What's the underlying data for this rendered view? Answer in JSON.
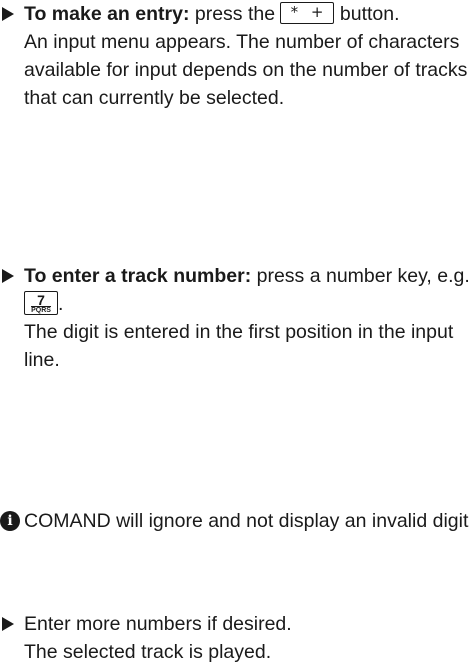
{
  "step1": {
    "bold": "To make an entry:",
    "text_before_key": " press the ",
    "key_label": "* +",
    "text_after_key": " button.",
    "description": "An input menu appears. The number of characters available for input depends on the number of tracks that can currently be selected."
  },
  "step2": {
    "bold": "To enter a track number:",
    "text": " press a number key, e.g. ",
    "key_digit": "7",
    "key_letters": "PQRS",
    "suffix": ".",
    "description": "The digit is entered in the first position in the input line."
  },
  "note": {
    "icon": "info-icon",
    "text": "COMAND will ignore and not display an invalid digit."
  },
  "step3": {
    "text": "Enter more numbers if desired.",
    "description": "The selected track is played."
  }
}
